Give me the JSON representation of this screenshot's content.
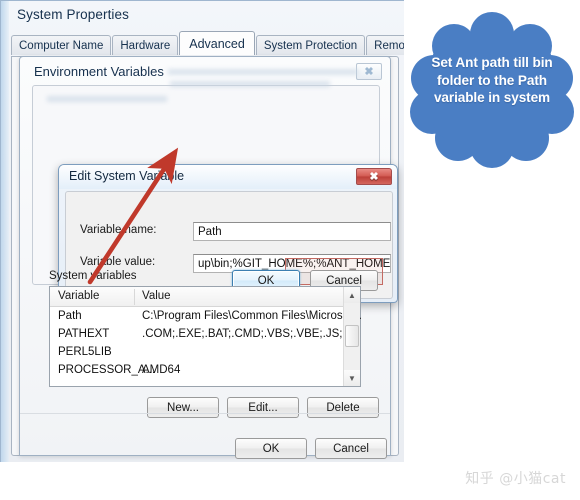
{
  "window": {
    "title": "System Properties",
    "tabs": [
      {
        "label": "Computer Name",
        "active": false
      },
      {
        "label": "Hardware",
        "active": false
      },
      {
        "label": "Advanced",
        "active": true
      },
      {
        "label": "System Protection",
        "active": false
      },
      {
        "label": "Remote",
        "active": false
      }
    ],
    "ok_label": "OK",
    "cancel_label": "Cancel"
  },
  "env_dialog": {
    "title": "Environment Variables",
    "close_glyph": "✖",
    "system_vars_label": "System variables",
    "columns": [
      "Variable",
      "Value"
    ],
    "rows": [
      {
        "variable": "Path",
        "value": "C:\\Program Files\\Common Files\\Microsof..."
      },
      {
        "variable": "PATHEXT",
        "value": ".COM;.EXE;.BAT;.CMD;.VBS;.VBE;.JS;...."
      },
      {
        "variable": "PERL5LIB",
        "value": ""
      },
      {
        "variable": "PROCESSOR_A...",
        "value": "AMD64"
      }
    ],
    "buttons": {
      "new_label": "New...",
      "edit_label": "Edit...",
      "delete_label": "Delete"
    },
    "scroll_up_glyph": "▲",
    "scroll_down_glyph": "▼"
  },
  "edit_dialog": {
    "title": "Edit System Variable",
    "close_glyph": "✖",
    "variable_name_label": "Variable name:",
    "variable_name_value": "Path",
    "variable_value_label": "Variable value:",
    "variable_value_value": "up\\bin;%GIT_HOME%;%ANT_HOME%\\bin",
    "highlighted_fragment": "%ANT_HOME%\\bin",
    "ok_label": "OK",
    "cancel_label": "Cancel"
  },
  "annotations": {
    "callout_text": "Set Ant path till bin folder to the Path variable in system",
    "callout_color": "#4a7ec4",
    "arrow_color": "#c0392b"
  },
  "watermark": {
    "text": "知乎 @小猫cat"
  }
}
